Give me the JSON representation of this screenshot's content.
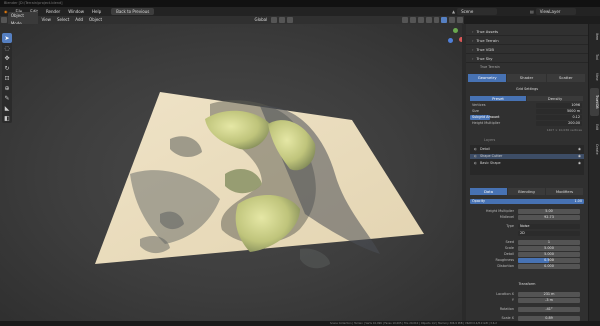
{
  "window_title": "Blender [D:\\Terrain\\project.blend]",
  "menu": {
    "items": [
      "File",
      "Edit",
      "Render",
      "Window",
      "Help"
    ],
    "back_button": "Back to Previous",
    "scene_label": "Scene",
    "viewlayer_label": "ViewLayer"
  },
  "viewport_header": {
    "mode": "Object Mode",
    "items": [
      "View",
      "Select",
      "Add",
      "Object"
    ],
    "transform": "Global",
    "options": "Options"
  },
  "toolbar": {
    "icons": [
      "cursor-select-icon",
      "select-box-icon",
      "move-icon",
      "rotate-icon",
      "scale-icon",
      "transform-icon",
      "annotate-icon",
      "measure-icon",
      "add-cube-icon"
    ]
  },
  "npanel": {
    "sections": [
      "True Assets",
      "True Terrain",
      "True VDB",
      "True Sky"
    ],
    "terrain_name": "True Terrain",
    "tabs": [
      "Geometry",
      "Shader",
      "Scatter"
    ],
    "grid_settings_title": "Grid Settings",
    "grid_tabs": [
      "Preset",
      "Density"
    ],
    "grid_rows": [
      {
        "label": "Vertices",
        "value": "1096"
      },
      {
        "label": "Size",
        "value": "5000 m"
      },
      {
        "label": "Subgrid Amount",
        "value": "0.12"
      },
      {
        "label": "Height Multiplier",
        "value": "200.00"
      }
    ],
    "grid_footnote": "1407 × 10,036 vertices",
    "modifier_header": "Layers",
    "modifiers": [
      "Detail",
      "Shape Cutter",
      "Basic Shape"
    ],
    "data_tabs": [
      "Data",
      "Blending",
      "Modifiers"
    ],
    "opacity_label": "Opacity",
    "opacity_value": "1.00",
    "layer_rows": [
      {
        "label": "Height Multiplier",
        "value": "5.00"
      },
      {
        "label": "Midlevel",
        "value": "92.73"
      },
      {
        "label": "Type",
        "value": "Noise"
      },
      {
        "label": "",
        "value": "2D"
      },
      {
        "label": "Seed",
        "value": "1"
      },
      {
        "label": "Scale",
        "value": "5.000"
      },
      {
        "label": "Detail",
        "value": "5.000"
      },
      {
        "label": "Roughness",
        "value": "0.500"
      },
      {
        "label": "Distortion",
        "value": "0.000"
      }
    ],
    "transform_title": "Transform",
    "transform_rows": [
      {
        "label": "Location X",
        "value": "231 m"
      },
      {
        "label": "Y",
        "value": "-3 m"
      },
      {
        "label": "Rotation",
        "value": "-41°"
      },
      {
        "label": "Scale X",
        "value": "0.89"
      }
    ]
  },
  "vertical_tabs": [
    "Item",
    "Tool",
    "View",
    "TrueVDB",
    "Edit",
    "Create"
  ],
  "status_bar": "Scene Collection | Terrain | Verts 10,096 | Faces 10,005 | Tris 20,010 | Objects 1/2 | Memory 306.9 MiB | VRAM 0.4/8.0 GiB | 3.6.2"
}
